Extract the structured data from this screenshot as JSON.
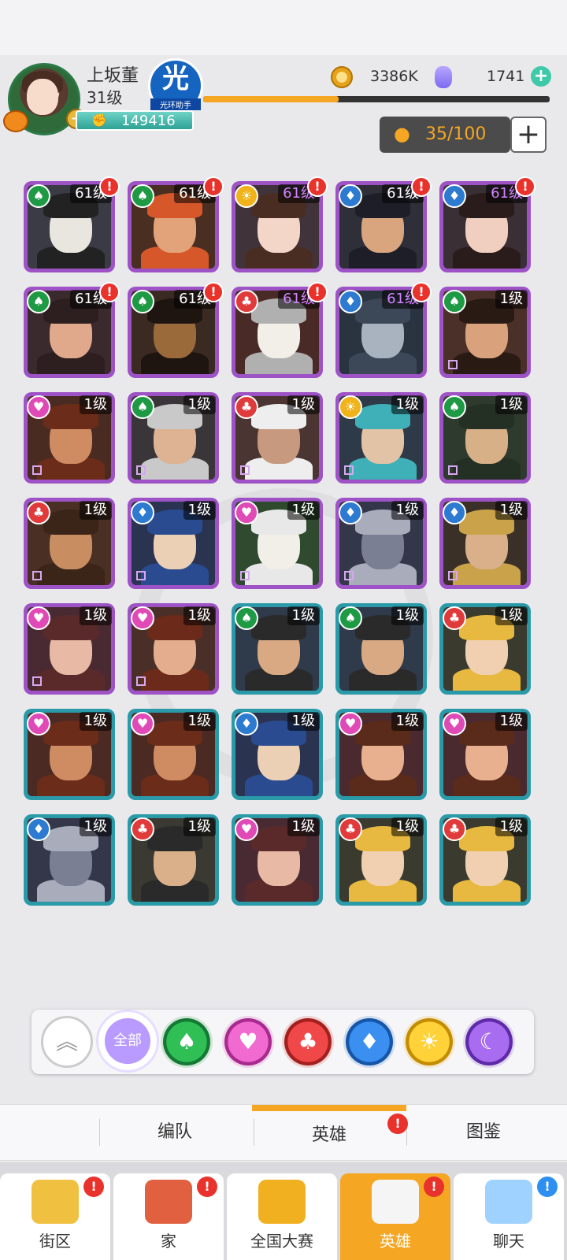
{
  "player": {
    "name": "上坂董",
    "level": "31级",
    "power": "149416",
    "badge_char": "光",
    "badge_sub": "光环助手"
  },
  "currency": {
    "gold": "3386K",
    "gems": "1741",
    "xp_progress": 0.39
  },
  "capacity": {
    "value": "35/100",
    "add": "+"
  },
  "heroes": [
    {
      "level": "61级",
      "suit": "green",
      "frame": "purple",
      "alert": true,
      "hi": false
    },
    {
      "level": "61级",
      "suit": "green",
      "frame": "purple",
      "alert": true,
      "hi": false
    },
    {
      "level": "61级",
      "suit": "gold",
      "frame": "purple",
      "alert": true,
      "hi": true
    },
    {
      "level": "61级",
      "suit": "blue",
      "frame": "purple",
      "alert": true,
      "hi": false
    },
    {
      "level": "61级",
      "suit": "blue",
      "frame": "purple",
      "alert": true,
      "hi": true
    },
    {
      "level": "61级",
      "suit": "green",
      "frame": "purple",
      "alert": true,
      "hi": false
    },
    {
      "level": "61级",
      "suit": "green",
      "frame": "purple",
      "alert": true,
      "hi": false
    },
    {
      "level": "61级",
      "suit": "red",
      "frame": "purple",
      "alert": true,
      "hi": true
    },
    {
      "level": "61级",
      "suit": "blue",
      "frame": "purple",
      "alert": true,
      "hi": true
    },
    {
      "level": "1级",
      "suit": "green",
      "frame": "purple",
      "alert": false,
      "hi": false
    },
    {
      "level": "1级",
      "suit": "pink",
      "frame": "purple",
      "alert": false,
      "hi": false
    },
    {
      "level": "1级",
      "suit": "green",
      "frame": "purple",
      "alert": false,
      "hi": false
    },
    {
      "level": "1级",
      "suit": "red",
      "frame": "purple",
      "alert": false,
      "hi": false
    },
    {
      "level": "1级",
      "suit": "gold",
      "frame": "purple",
      "alert": false,
      "hi": false
    },
    {
      "level": "1级",
      "suit": "green",
      "frame": "purple",
      "alert": false,
      "hi": false
    },
    {
      "level": "1级",
      "suit": "red",
      "frame": "purple",
      "alert": false,
      "hi": false
    },
    {
      "level": "1级",
      "suit": "blue",
      "frame": "purple",
      "alert": false,
      "hi": false
    },
    {
      "level": "1级",
      "suit": "pink",
      "frame": "purple",
      "alert": false,
      "hi": false
    },
    {
      "level": "1级",
      "suit": "blue",
      "frame": "purple",
      "alert": false,
      "hi": false
    },
    {
      "level": "1级",
      "suit": "blue",
      "frame": "purple",
      "alert": false,
      "hi": false
    },
    {
      "level": "1级",
      "suit": "pink",
      "frame": "purple",
      "alert": false,
      "hi": false
    },
    {
      "level": "1级",
      "suit": "pink",
      "frame": "purple",
      "alert": false,
      "hi": false
    },
    {
      "level": "1级",
      "suit": "green",
      "frame": "teal",
      "alert": false,
      "hi": false
    },
    {
      "level": "1级",
      "suit": "green",
      "frame": "teal",
      "alert": false,
      "hi": false
    },
    {
      "level": "1级",
      "suit": "red",
      "frame": "teal",
      "alert": false,
      "hi": false
    },
    {
      "level": "1级",
      "suit": "pink",
      "frame": "teal",
      "alert": false,
      "hi": false
    },
    {
      "level": "1级",
      "suit": "pink",
      "frame": "teal",
      "alert": false,
      "hi": false
    },
    {
      "level": "1级",
      "suit": "blue",
      "frame": "teal",
      "alert": false,
      "hi": false
    },
    {
      "level": "1级",
      "suit": "pink",
      "frame": "teal",
      "alert": false,
      "hi": false
    },
    {
      "level": "1级",
      "suit": "pink",
      "frame": "teal",
      "alert": false,
      "hi": false
    },
    {
      "level": "1级",
      "suit": "blue",
      "frame": "teal",
      "alert": false,
      "hi": false
    },
    {
      "level": "1级",
      "suit": "red",
      "frame": "teal",
      "alert": false,
      "hi": false
    },
    {
      "level": "1级",
      "suit": "pink",
      "frame": "teal",
      "alert": false,
      "hi": false
    },
    {
      "level": "1级",
      "suit": "red",
      "frame": "teal",
      "alert": false,
      "hi": false
    },
    {
      "level": "1级",
      "suit": "red",
      "frame": "teal",
      "alert": false,
      "hi": false
    }
  ],
  "filters": {
    "all_label": "全部",
    "items": [
      "collapse",
      "all",
      "green",
      "pink",
      "red",
      "blue",
      "gold",
      "purple"
    ]
  },
  "subtabs": [
    {
      "label": "编队",
      "active": false
    },
    {
      "label": "英雄",
      "active": true
    },
    {
      "label": "图鉴",
      "active": false
    }
  ],
  "nav": [
    {
      "label": "街区",
      "active": false,
      "alert": "!",
      "info": false
    },
    {
      "label": "家",
      "active": false,
      "alert": "!",
      "info": false
    },
    {
      "label": "全国大赛",
      "active": false,
      "alert": "",
      "info": false
    },
    {
      "label": "英雄",
      "active": true,
      "alert": "!",
      "info": false
    },
    {
      "label": "聊天",
      "active": false,
      "alert": "!",
      "info": true
    }
  ],
  "colors": {
    "purple_frame": "#9d52c5",
    "teal_frame": "#2a9aa8",
    "accent": "#f5a623",
    "alert": "#e8322b"
  }
}
